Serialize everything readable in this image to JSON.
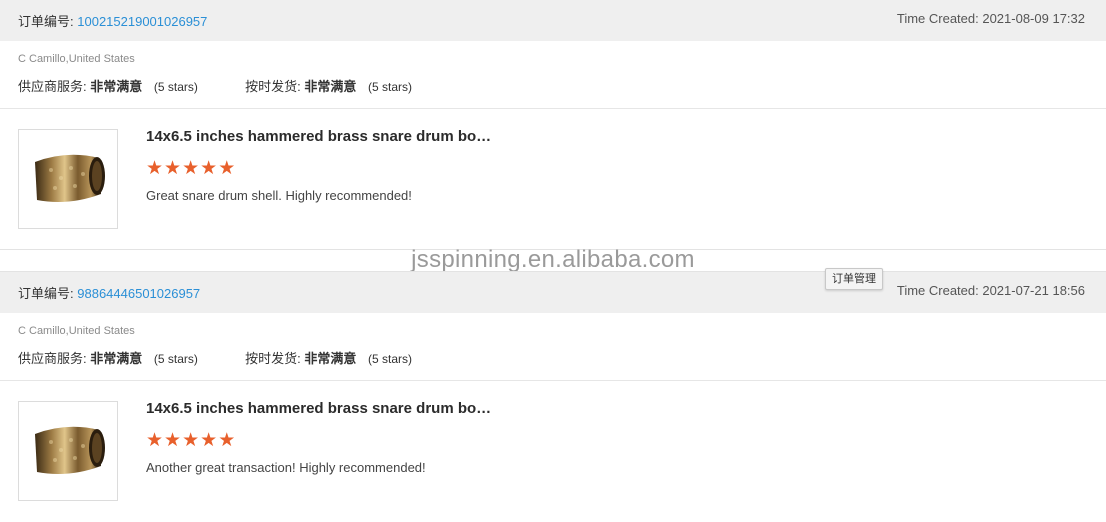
{
  "orders": [
    {
      "order_label": "订单编号:",
      "order_number": "100215219001026957",
      "time_created": "Time Created: 2021-08-09 17:32",
      "buyer": "C Camillo,United States",
      "supplier_service_label": "供应商服务:",
      "supplier_service_value": "非常满意",
      "supplier_service_stars": "(5 stars)",
      "shipping_label": "按时发货:",
      "shipping_value": "非常满意",
      "shipping_stars": "(5 stars)",
      "product_title": "14x6.5 inches hammered brass snare drum bo…",
      "rating": 5,
      "comment": "Great snare drum shell.  Highly recommended!"
    },
    {
      "order_label": "订单编号:",
      "order_number": "98864446501026957",
      "time_created": "Time Created: 2021-07-21 18:56",
      "buyer": "C Camillo,United States",
      "supplier_service_label": "供应商服务:",
      "supplier_service_value": "非常满意",
      "supplier_service_stars": "(5 stars)",
      "shipping_label": "按时发货:",
      "shipping_value": "非常满意",
      "shipping_stars": "(5 stars)",
      "product_title": "14x6.5 inches hammered brass snare drum bo…",
      "rating": 5,
      "comment": "Another great transaction!  Highly recommended!"
    }
  ],
  "watermark": "jsspinning.en.alibaba.com",
  "tooltip": "订单管理",
  "colors": {
    "accent_link": "#2a8fd6",
    "star": "#e8602c",
    "header_bg": "#efefef"
  },
  "icons": {
    "star": "star-icon",
    "product": "brass-drum-shell-image"
  }
}
